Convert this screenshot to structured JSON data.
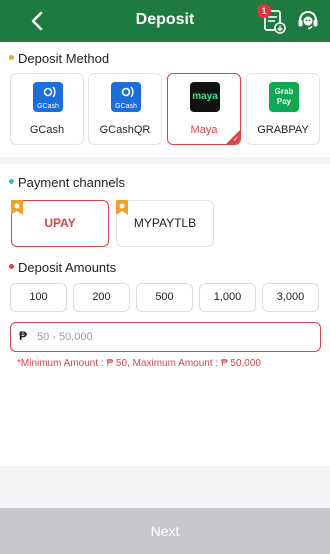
{
  "header": {
    "title": "Deposit",
    "badge_count": "1"
  },
  "deposit_method": {
    "title": "Deposit Method",
    "items": [
      {
        "label": "GCash",
        "logo_text": "GCash"
      },
      {
        "label": "GCashQR",
        "logo_text": "GCash"
      },
      {
        "label": "Maya",
        "logo_text": "maya"
      },
      {
        "label": "GRABPAY",
        "logo_text": "Grab Pay"
      }
    ],
    "selected": "Maya"
  },
  "payment_channels": {
    "title": "Payment channels",
    "items": [
      {
        "label": "UPAY"
      },
      {
        "label": "MYPAYTLB"
      }
    ],
    "selected": "UPAY"
  },
  "deposit_amounts": {
    "title": "Deposit Amounts",
    "items": [
      "100",
      "200",
      "500",
      "1,000",
      "3,000"
    ],
    "currency_symbol": "₱",
    "placeholder": "50 - 50,000",
    "value": "",
    "hint": "*Minimum Amount : ₱ 50,  Maximum Amount : ₱ 50,000"
  },
  "footer": {
    "next_label": "Next"
  },
  "colors": {
    "header_green": "#1d7a41",
    "accent_red": "#d4474b",
    "disabled_gray": "#c8c8cc"
  }
}
